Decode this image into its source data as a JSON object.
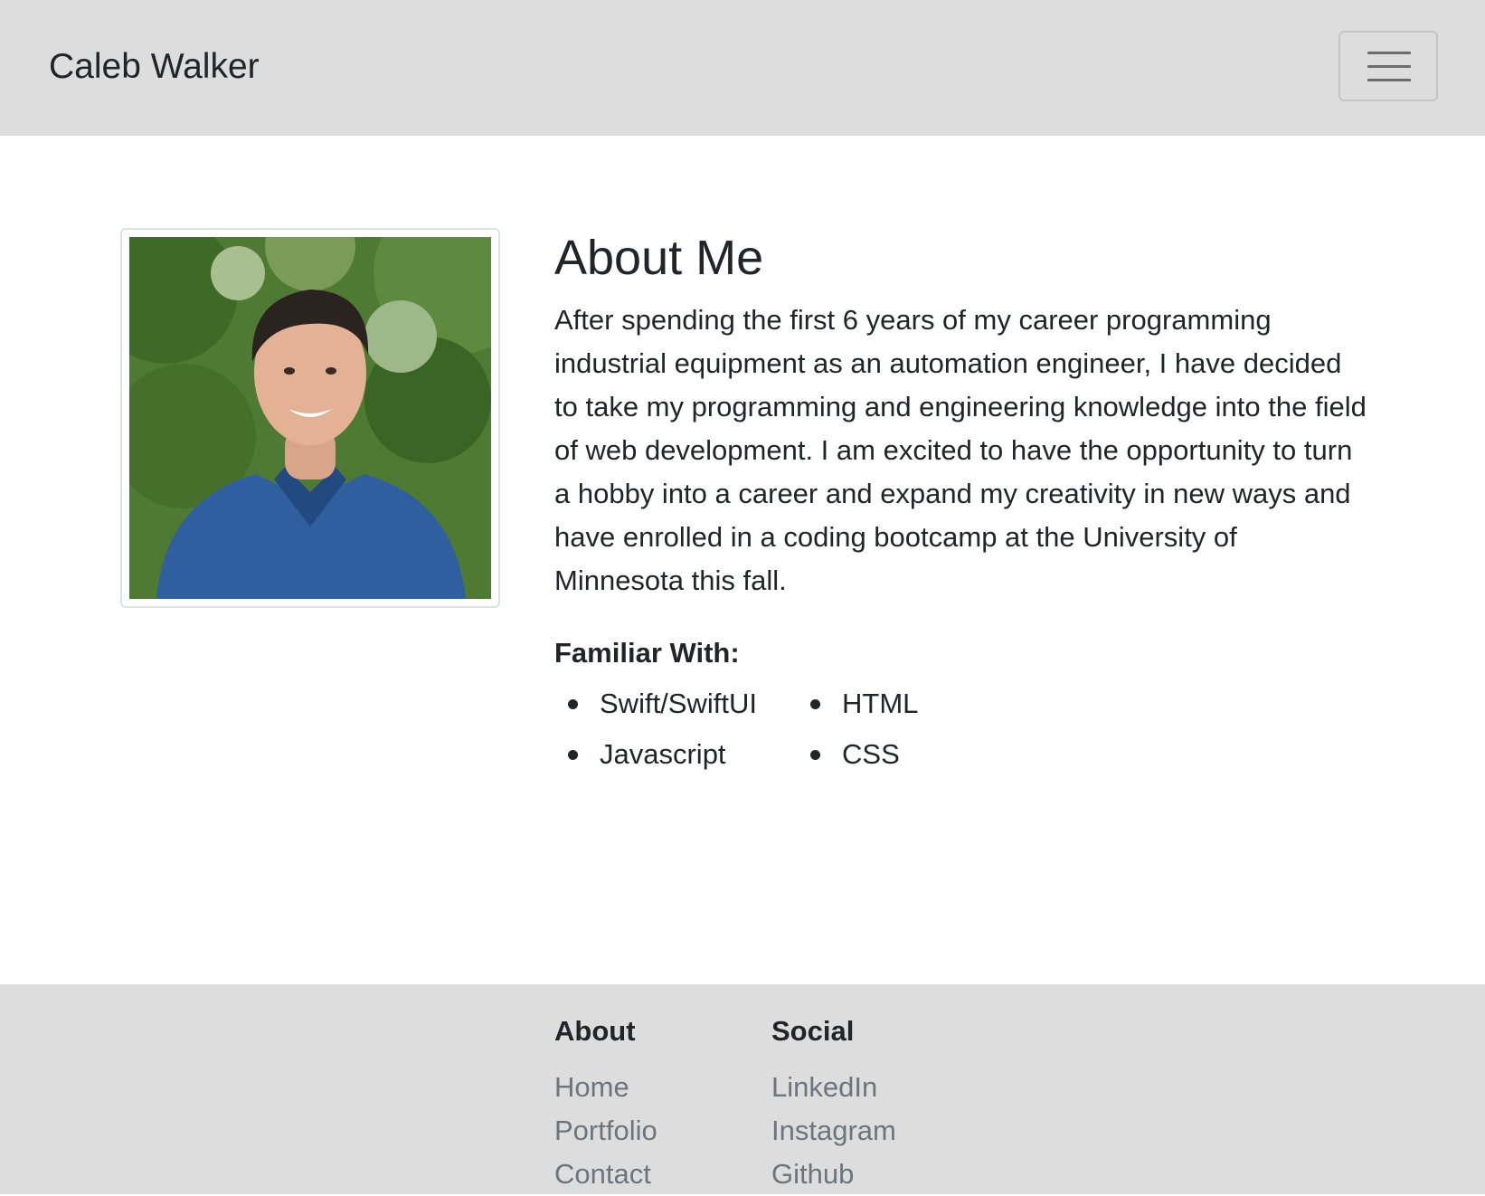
{
  "navbar": {
    "brand": "Caleb Walker",
    "toggler_icon": "hamburger-menu-icon"
  },
  "about": {
    "photo_alt": "Portrait photo",
    "title": "About Me",
    "bio": "After spending the first 6 years of my career programming industrial equipment as an automation engineer, I have decided to take my programming and engineering knowledge into the field of web development. I am excited to have the opportunity to turn a hobby into a career and expand my creativity in new ways and have enrolled in a coding bootcamp at the University of Minnesota this fall.",
    "familiar_heading": "Familiar With:",
    "skills": [
      "Swift/SwiftUI",
      "HTML",
      "Javascript",
      "CSS"
    ]
  },
  "footer": {
    "about": {
      "heading": "About",
      "links": [
        "Home",
        "Portfolio",
        "Contact"
      ]
    },
    "social": {
      "heading": "Social",
      "links": [
        "LinkedIn",
        "Instagram",
        "Github"
      ]
    }
  },
  "colors": {
    "bar_background": "#dddddd",
    "text": "#212529",
    "link_muted": "#6c757d"
  }
}
